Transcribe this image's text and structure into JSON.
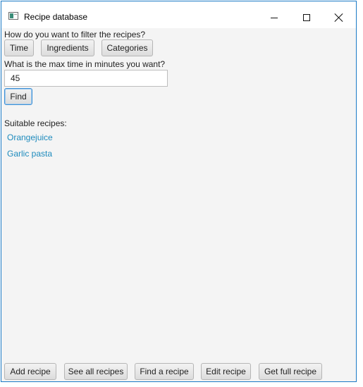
{
  "window": {
    "title": "Recipe database"
  },
  "filter": {
    "prompt": "How do you want to filter the recipes?",
    "buttons": [
      "Time",
      "Ingredients",
      "Categories"
    ]
  },
  "time_filter": {
    "prompt": "What is the max time in minutes you want?",
    "value": "45",
    "find_label": "Find"
  },
  "results": {
    "heading": "Suitable recipes:",
    "items": [
      "Orangejuice",
      "Garlic pasta"
    ]
  },
  "bottom_bar": {
    "buttons": [
      "Add recipe",
      "See all recipes",
      "Find a recipe",
      "Edit recipe",
      "Get full recipe"
    ]
  }
}
